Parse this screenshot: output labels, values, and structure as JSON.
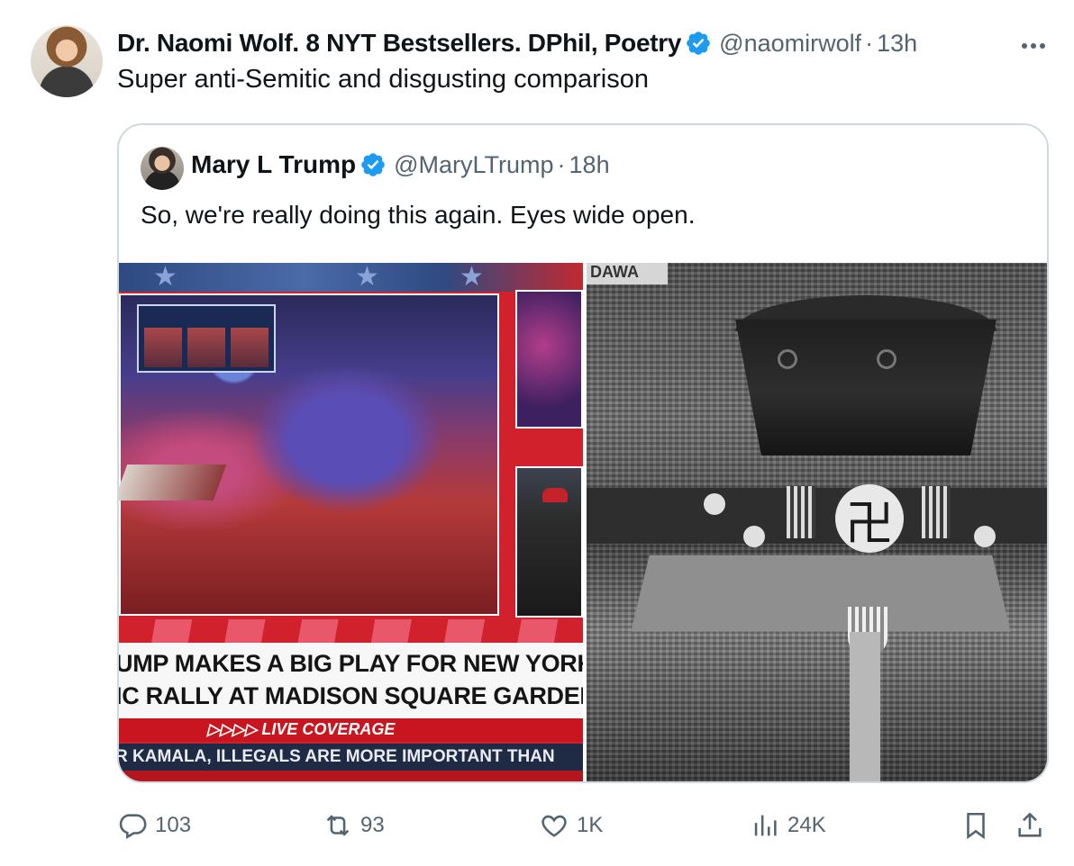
{
  "tweet": {
    "display_name": "Dr. Naomi Wolf. 8 NYT Bestsellers. DPhil, Poetry",
    "handle": "@naomirwolf",
    "separator": "·",
    "time": "13h",
    "more_label": "···",
    "text": "Super anti-Semitic and disgusting comparison"
  },
  "quote": {
    "display_name": "Mary L Trump",
    "handle": "@MaryLTrump",
    "separator": "·",
    "time": "18h",
    "text": "So, we're really doing this again. Eyes wide open.",
    "media_left": {
      "lower_third_line1": "UMP MAKES A BIG PLAY FOR NEW YORK",
      "lower_third_line2": "IC RALLY AT MADISON SQUARE GARDEN",
      "live_label": "▷▷▷▷ LIVE COVERAGE",
      "ticker": "R KAMALA, ILLEGALS ARE MORE IMPORTANT THAN"
    },
    "media_right": {
      "banner": "DAWA"
    }
  },
  "actions": {
    "replies": "103",
    "reposts": "93",
    "likes": "1K",
    "views": "24K"
  },
  "colors": {
    "verified": "#1d9bf0",
    "secondary_text": "#536471",
    "border": "#cfd9de"
  },
  "icons": [
    "verified-badge-icon",
    "more-icon",
    "reply-icon",
    "repost-icon",
    "like-icon",
    "views-icon",
    "bookmark-icon",
    "share-icon"
  ]
}
